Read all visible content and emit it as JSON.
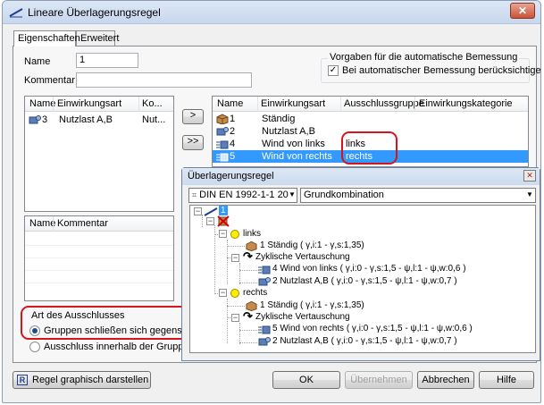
{
  "window": {
    "title": "Lineare Überlagerungsregel",
    "close_glyph": "✕"
  },
  "tabs": [
    {
      "label": "Eigenschaften"
    },
    {
      "label": "Erweitert"
    }
  ],
  "fields": {
    "name_label": "Name",
    "name_value": "1",
    "kommentar_label": "Kommentar",
    "kommentar_value": ""
  },
  "vorgaben": {
    "title": "Vorgaben für die automatische Bemessung",
    "checkbox_label": "Bei automatischer Bemessung berücksichtigen",
    "checked": true
  },
  "left_list": {
    "headers": [
      "Name",
      "Einwirkungsart",
      "Ko..."
    ],
    "rows": [
      {
        "name": "3",
        "art": "Nutzlast A,B",
        "ko": "Nut..."
      }
    ]
  },
  "comment_list": {
    "headers": [
      "Name",
      "Kommentar"
    ]
  },
  "move_buttons": {
    "single": ">",
    "all": ">>"
  },
  "right_list": {
    "headers": [
      "Name",
      "Einwirkungsart",
      "Ausschlussgruppe",
      "Einwirkungskategorie"
    ],
    "rows": [
      {
        "name": "1",
        "art": "Ständig",
        "gruppe": "",
        "kategorie": ""
      },
      {
        "name": "2",
        "art": "Nutzlast A,B",
        "gruppe": "",
        "kategorie": ""
      },
      {
        "name": "4",
        "art": "Wind von links",
        "gruppe": "links",
        "kategorie": ""
      },
      {
        "name": "5",
        "art": "Wind von rechts",
        "gruppe": "rechts",
        "kategorie": ""
      }
    ]
  },
  "ausschluss": {
    "title": "Art des Ausschlusses",
    "option1": "Gruppen schließen sich gegenseitig aus",
    "option2": "Ausschluss innerhalb der Gruppen"
  },
  "bottom": {
    "graph_button_icon": "R",
    "graph_button": "Regel graphisch darstellen",
    "ok": "OK",
    "apply": "Übernehmen",
    "cancel": "Abbrechen",
    "help": "Hilfe"
  },
  "sub_window": {
    "title": "Überlagerungsregel",
    "close_glyph": "✕",
    "norm": "DIN EN 1992-1-1 20",
    "kombination": "Grundkombination",
    "tree": {
      "root": "1",
      "group1": "links",
      "g1_item1": "1 Ständig ( γ,i:1 - γ,s:1,35)",
      "g1_zykl": "Zyklische Vertauschung",
      "g1_z1": "4 Wind von links ( γ,i:0 - γ,s:1,5 - ψ,l:1 - ψ,w:0,6 )",
      "g1_z2": "2 Nutzlast A,B ( γ,i:0 - γ,s:1,5 - ψ,l:1 - ψ,w:0,7 )",
      "group2": "rechts",
      "g2_item1": "1 Ständig ( γ,i:1 - γ,s:1,35)",
      "g2_zykl": "Zyklische Vertauschung",
      "g2_z1": "5 Wind von rechts ( γ,i:0 - γ,s:1,5 - ψ,l:1 - ψ,w:0,6 )",
      "g2_z2": "2 Nutzlast A,B ( γ,i:0 - γ,s:1,5 - ψ,l:1 - ψ,w:0,7 )"
    }
  },
  "colors": {
    "selection": "#3399ff",
    "annotation": "#d4161c",
    "node_yellow": "#ffee00",
    "load_brown": "#c58a4a"
  }
}
